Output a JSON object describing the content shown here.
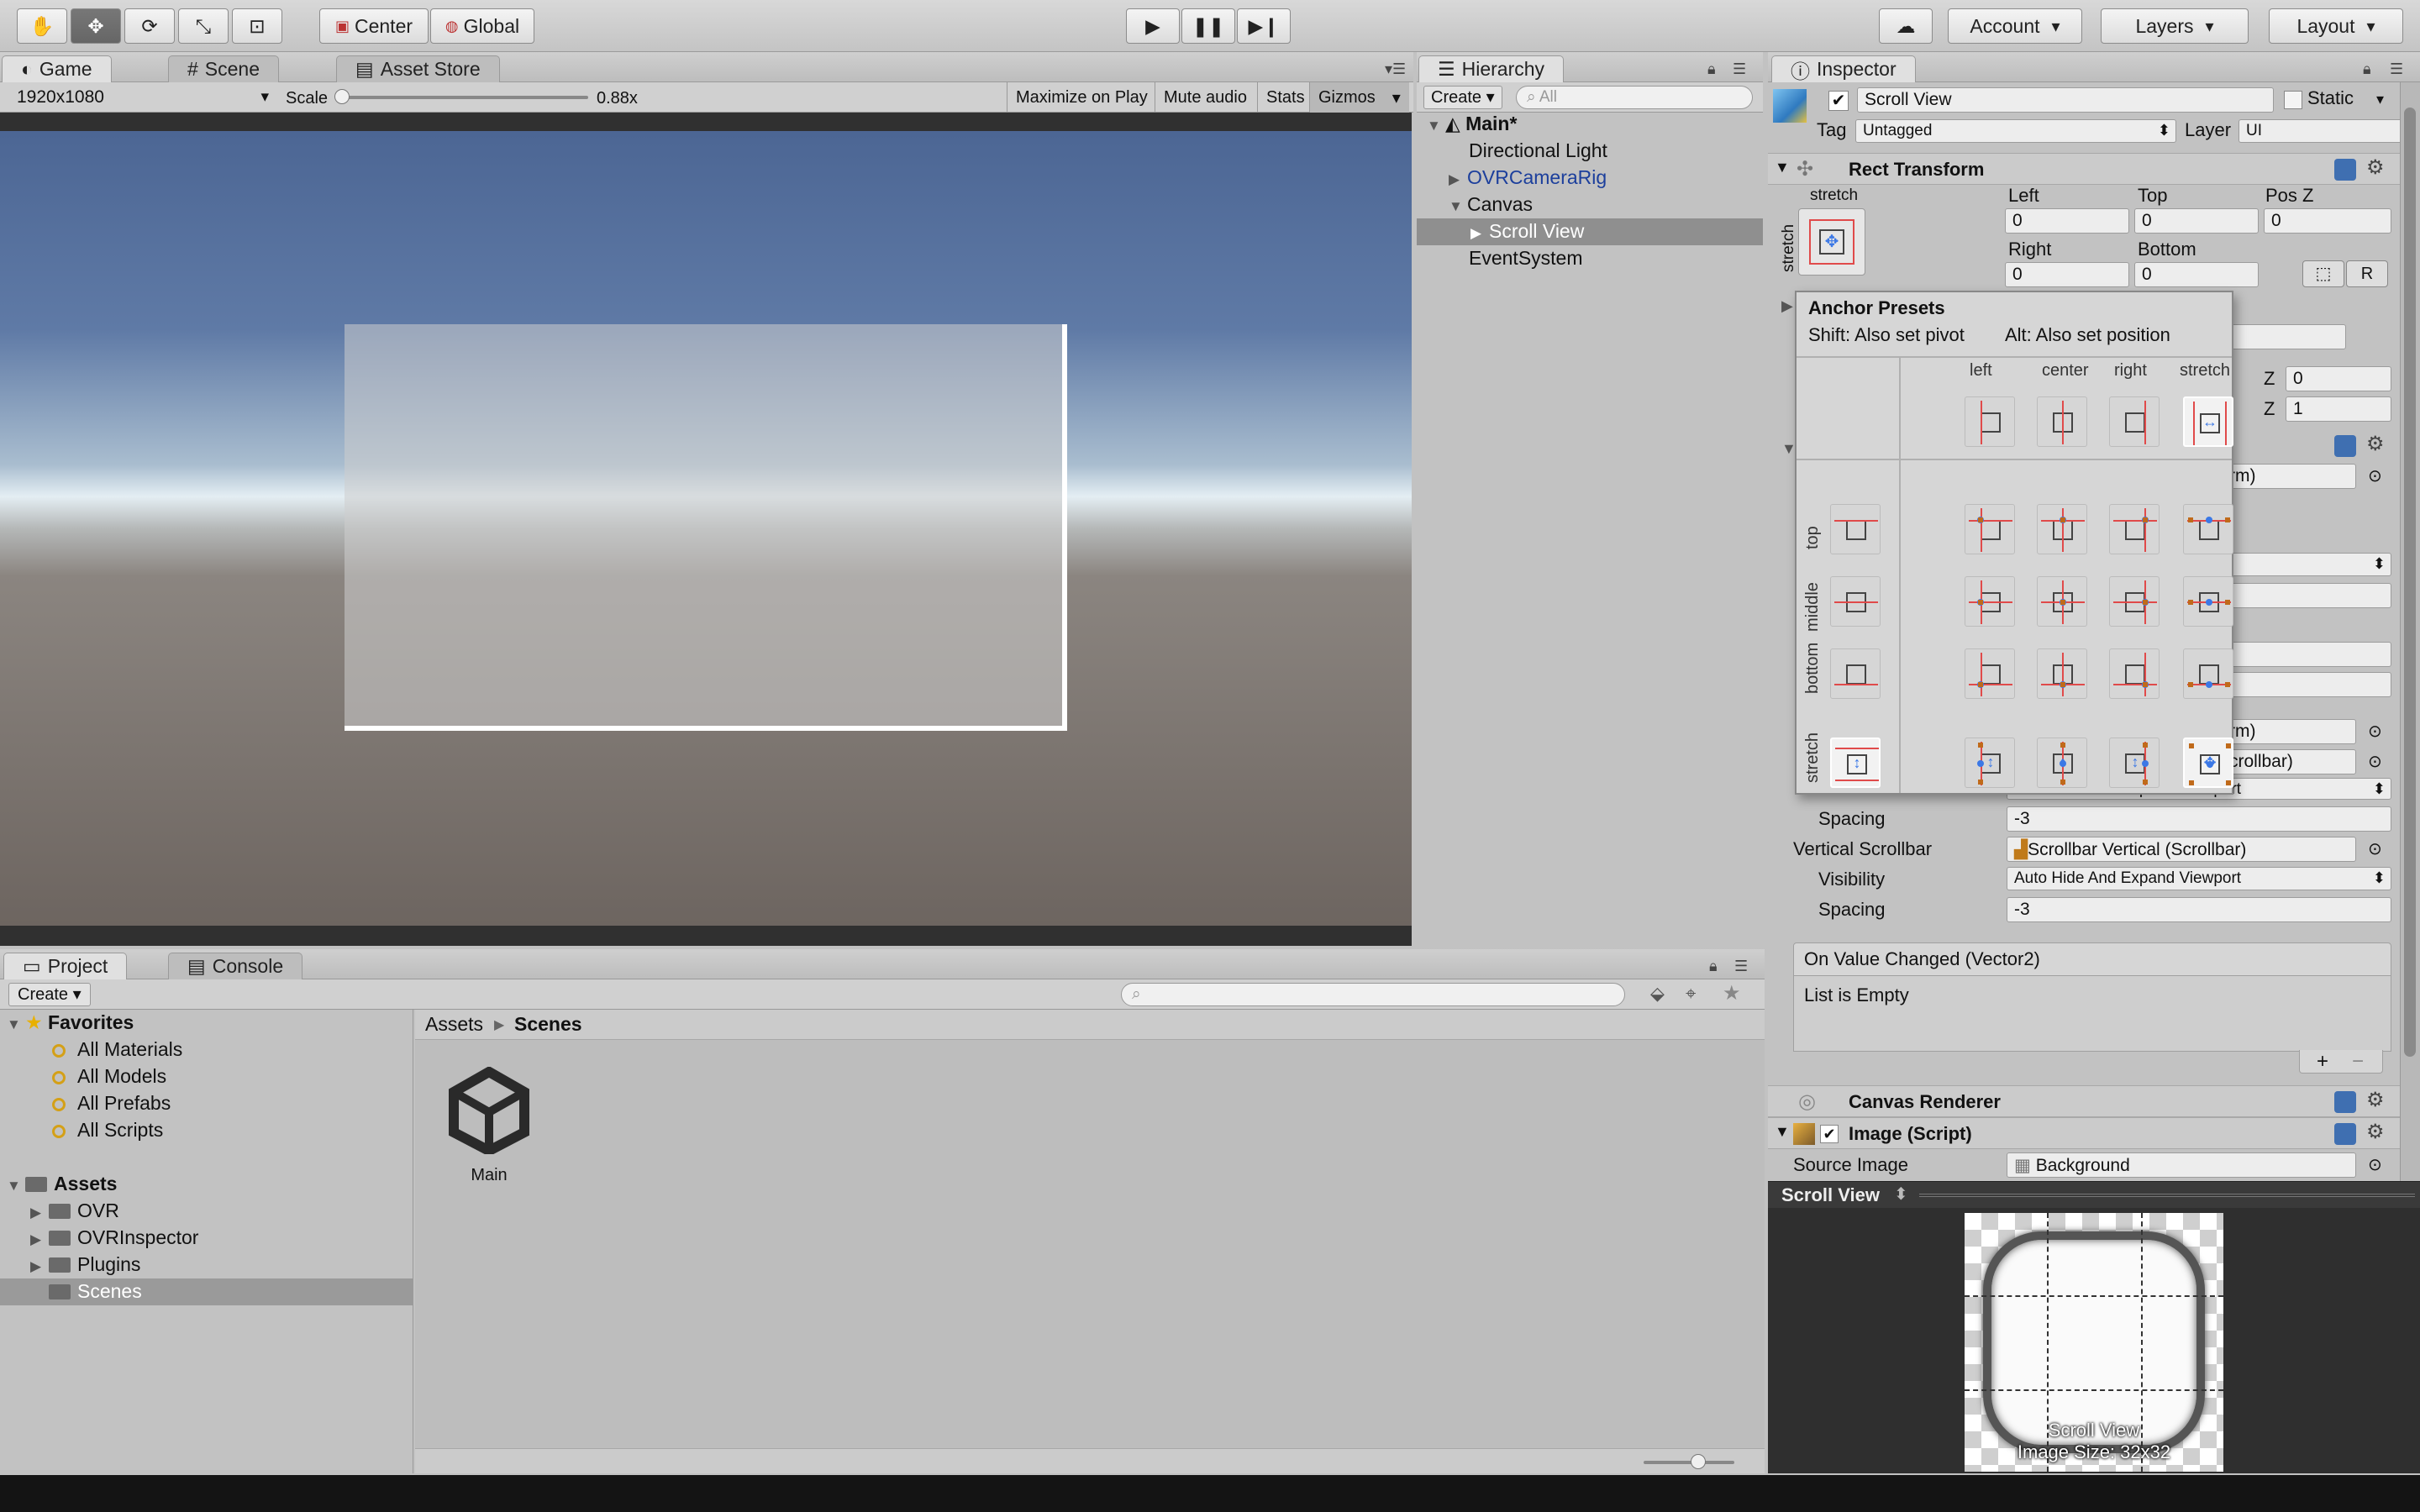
{
  "toolbar": {
    "pivot_label": "Center",
    "space_label": "Global",
    "account_label": "Account",
    "layers_label": "Layers",
    "layout_label": "Layout"
  },
  "game": {
    "tab_game": "Game",
    "tab_scene": "Scene",
    "tab_asset_store": "Asset Store",
    "resolution": "1920x1080",
    "scale_label": "Scale",
    "scale_value": "0.88x",
    "scale_level": 0.0,
    "maximize": "Maximize on Play",
    "mute": "Mute audio",
    "stats": "Stats",
    "gizmos": "Gizmos"
  },
  "hierarchy": {
    "tab": "Hierarchy",
    "create": "Create",
    "search_placeholder": "All",
    "scene": "Main*",
    "items": [
      "Directional Light",
      "OVRCameraRig",
      "Canvas",
      "Scroll View",
      "EventSystem"
    ]
  },
  "inspector": {
    "tab": "Inspector",
    "object_name": "Scroll View",
    "static_label": "Static",
    "tag_label": "Tag",
    "tag_value": "Untagged",
    "layer_label": "Layer",
    "layer_value": "UI",
    "rect_transform": "Rect Transform",
    "stretch_top": "stretch",
    "stretch_side": "stretch",
    "col_left": "Left",
    "col_top": "Top",
    "col_posz": "Pos Z",
    "left_val": "0",
    "top_val": "0",
    "posz_val": "0",
    "right_label": "Right",
    "bottom_label": "Bottom",
    "right_val": "0",
    "bottom_val": "0",
    "r_button": "R",
    "z_label": "Z",
    "z_val1": "0",
    "z_val2": "1",
    "partial_field1": "rm)",
    "partial_field2": "rm)",
    "partial_field3": "crollbar)",
    "partial_visibility": "Auto Hide And Expand Viewport",
    "spacing_label": "Spacing",
    "spacing_val": "-3",
    "vscroll_label": "Vertical Scrollbar",
    "vscroll_value": "Scrollbar Vertical (Scrollbar)",
    "visibility_label": "Visibility",
    "visibility_value": "Auto Hide And Expand Viewport",
    "spacing2_label": "Spacing",
    "spacing2_val": "-3",
    "on_value_changed": "On Value Changed (Vector2)",
    "list_empty": "List is Empty",
    "canvas_renderer": "Canvas Renderer",
    "image_script": "Image (Script)",
    "source_image_label": "Source Image",
    "source_image_value": "Background",
    "preview_header": "Scroll View",
    "preview_name": "Scroll View",
    "preview_size": "Image Size: 32x32"
  },
  "anchor_presets": {
    "title": "Anchor Presets",
    "shift_hint": "Shift: Also set pivot",
    "alt_hint": "Alt: Also set position",
    "cols": [
      "left",
      "center",
      "right",
      "stretch"
    ],
    "rows": [
      "top",
      "middle",
      "bottom",
      "stretch"
    ]
  },
  "project": {
    "tab_project": "Project",
    "tab_console": "Console",
    "create": "Create",
    "favorites": "Favorites",
    "fav_items": [
      "All Materials",
      "All Models",
      "All Prefabs",
      "All Scripts"
    ],
    "assets": "Assets",
    "asset_folders": [
      "OVR",
      "OVRInspector",
      "Plugins",
      "Scenes"
    ],
    "breadcrumb_root": "Assets",
    "breadcrumb_current": "Scenes",
    "file_name": "Main"
  }
}
